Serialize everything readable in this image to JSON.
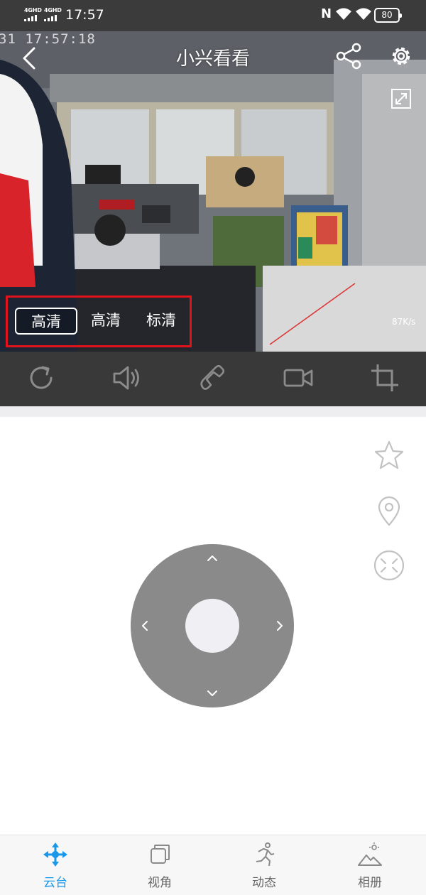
{
  "status_bar": {
    "sim1_network": "4GHD",
    "sim2_network": "4GHD",
    "time": "17:57",
    "nfc_icon": "nfc-icon",
    "battery": "80"
  },
  "camera": {
    "timestamp": "31 17:57:18",
    "title": "小兴看看",
    "speed": "87K/s",
    "quality_options": [
      "高清",
      "高清",
      "标清"
    ],
    "selected_quality_index": 0,
    "highlight_color": "#e0121c"
  },
  "controls": [
    {
      "icon": "refresh-icon"
    },
    {
      "icon": "speaker-icon"
    },
    {
      "icon": "phone-icon"
    },
    {
      "icon": "video-record-icon"
    },
    {
      "icon": "crop-icon"
    }
  ],
  "ptz": {
    "side_icons": [
      "star-icon",
      "location-pin-icon",
      "close-circle-icon"
    ]
  },
  "bottom_nav": {
    "active_color": "#1a97e8",
    "items": [
      {
        "label": "云台",
        "icon": "ptz-move-icon",
        "active": true
      },
      {
        "label": "视角",
        "icon": "view-angle-icon",
        "active": false
      },
      {
        "label": "动态",
        "icon": "running-person-icon",
        "active": false
      },
      {
        "label": "相册",
        "icon": "album-icon",
        "active": false
      }
    ]
  }
}
